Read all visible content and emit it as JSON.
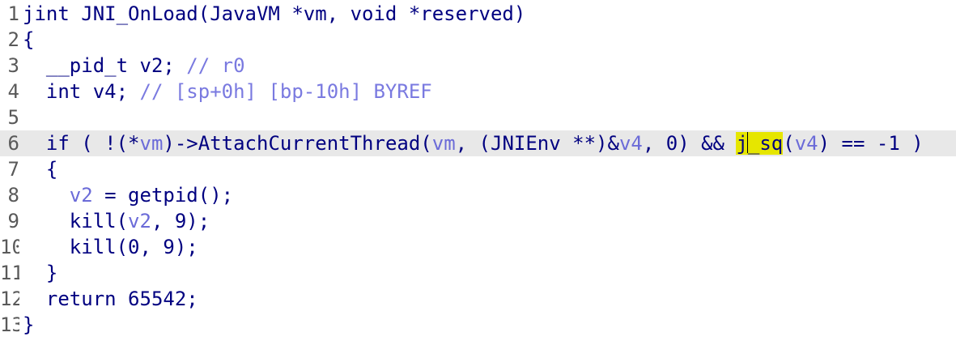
{
  "lines": [
    {
      "no": "1",
      "segments": [
        {
          "t": "jint JNI_OnLoad(JavaVM *vm, void *reserved)",
          "c": "kw"
        }
      ]
    },
    {
      "no": "2",
      "segments": [
        {
          "t": "{",
          "c": "kw"
        }
      ]
    },
    {
      "no": "3",
      "segments": [
        {
          "t": "  __pid_t v2; ",
          "c": "kw"
        },
        {
          "t": "// r0",
          "c": "cmt"
        }
      ]
    },
    {
      "no": "4",
      "segments": [
        {
          "t": "  int v4; ",
          "c": "kw"
        },
        {
          "t": "// [sp+0h] [bp-10h] BYREF",
          "c": "cmt"
        }
      ]
    },
    {
      "no": "5",
      "segments": []
    },
    {
      "no": "6",
      "current": true,
      "segments": [
        {
          "t": "  if ( !(*",
          "c": "kw"
        },
        {
          "t": "vm",
          "c": "var"
        },
        {
          "t": ")->AttachCurrentThread(",
          "c": "kw"
        },
        {
          "t": "vm",
          "c": "var"
        },
        {
          "t": ", (JNIEnv **)&",
          "c": "kw"
        },
        {
          "t": "v4",
          "c": "var"
        },
        {
          "t": ", 0) && ",
          "c": "kw"
        },
        {
          "t": "j",
          "c": "kw hl"
        },
        {
          "t": "CARET",
          "c": "caret"
        },
        {
          "t": "_sq",
          "c": "kw hl"
        },
        {
          "t": "(",
          "c": "kw"
        },
        {
          "t": "v4",
          "c": "var"
        },
        {
          "t": ") == -1 )",
          "c": "kw"
        }
      ]
    },
    {
      "no": "7",
      "segments": [
        {
          "t": "  {",
          "c": "kw"
        }
      ]
    },
    {
      "no": "8",
      "segments": [
        {
          "t": "    ",
          "c": "kw"
        },
        {
          "t": "v2",
          "c": "var"
        },
        {
          "t": " = getpid();",
          "c": "kw"
        }
      ]
    },
    {
      "no": "9",
      "segments": [
        {
          "t": "    kill(",
          "c": "kw"
        },
        {
          "t": "v2",
          "c": "var"
        },
        {
          "t": ", 9);",
          "c": "kw"
        }
      ]
    },
    {
      "no": "10",
      "segments": [
        {
          "t": "    kill(0, 9);",
          "c": "kw"
        }
      ]
    },
    {
      "no": "11",
      "segments": [
        {
          "t": "  }",
          "c": "kw"
        }
      ]
    },
    {
      "no": "12",
      "segments": [
        {
          "t": "  return 65542;",
          "c": "kw"
        }
      ]
    },
    {
      "no": "13",
      "segments": [
        {
          "t": "}",
          "c": "kw"
        }
      ]
    }
  ]
}
